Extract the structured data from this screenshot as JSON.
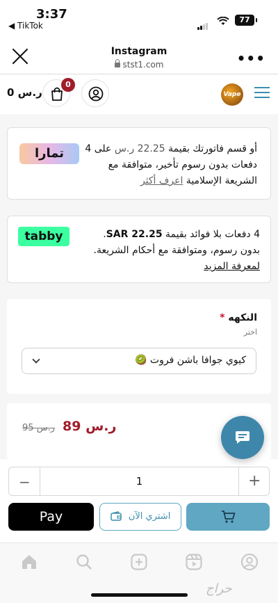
{
  "status_bar": {
    "time": "3:37",
    "back_app": "◀ TikTok",
    "battery": "77"
  },
  "browser": {
    "title": "Instagram",
    "url": "stst1.com"
  },
  "store_header": {
    "total": "0 ر.س",
    "cart_count": "0",
    "logo_text": "Vape"
  },
  "tamara": {
    "logo": "تمارا",
    "text_before": "أو قسم فاتورتك بقيمة ",
    "amount": "22.25 ر.س",
    "text_after": " على 4 دفعات بدون رسوم تأخير، متوافقة مع الشريعة الإسلامية ",
    "link": "اعرف أكثر"
  },
  "tabby": {
    "logo": "tabby",
    "text_before": "4 دفعات بلا فوائد بقيمة ",
    "amount": "SAR 22.25",
    "text_after": ". بدون رسوم، ومتوافقة مع أحكام الشريعة.",
    "link": "لمعرفة المزيد"
  },
  "flavor": {
    "label": "النكهه",
    "required_mark": "*",
    "hint": "اختر",
    "selected": "كيوي جوافا باشن فروت 🥝"
  },
  "pricing": {
    "new_price": "89 ر.س",
    "old_price": "95 ر.س"
  },
  "quantity": {
    "minus": "−",
    "value": "1",
    "plus": "+"
  },
  "actions": {
    "apple_pay": " Pay",
    "buy_now": "اشتري الآن"
  },
  "watermark": "حراج"
}
